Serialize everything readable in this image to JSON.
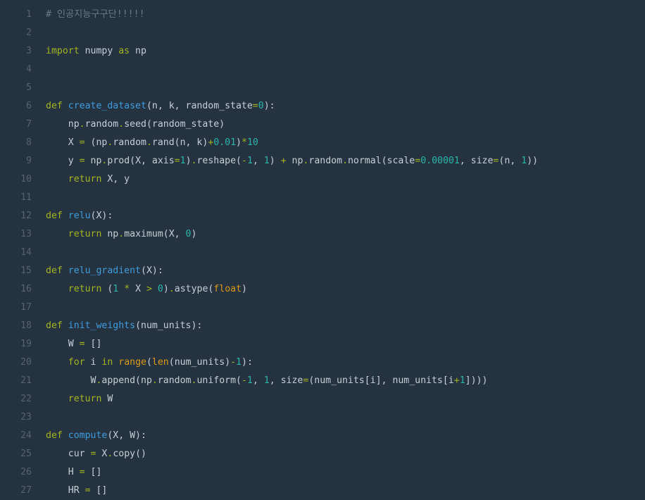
{
  "editor": {
    "lines": [
      {
        "number": "1",
        "tokens": [
          {
            "t": "# 인공지능구구단!!!!!",
            "k": "comment"
          }
        ]
      },
      {
        "number": "2",
        "tokens": []
      },
      {
        "number": "3",
        "tokens": [
          {
            "t": "import",
            "k": "keyword"
          },
          {
            "t": " numpy ",
            "k": "text"
          },
          {
            "t": "as",
            "k": "keyword"
          },
          {
            "t": " np",
            "k": "text"
          }
        ]
      },
      {
        "number": "4",
        "tokens": []
      },
      {
        "number": "5",
        "tokens": []
      },
      {
        "number": "6",
        "tokens": [
          {
            "t": "def",
            "k": "keyword"
          },
          {
            "t": " ",
            "k": "text"
          },
          {
            "t": "create_dataset",
            "k": "func"
          },
          {
            "t": "(n, k, random_state",
            "k": "text"
          },
          {
            "t": "=",
            "k": "op"
          },
          {
            "t": "0",
            "k": "number"
          },
          {
            "t": "):",
            "k": "text"
          }
        ]
      },
      {
        "number": "7",
        "tokens": [
          {
            "t": "    np",
            "k": "text"
          },
          {
            "t": ".",
            "k": "op"
          },
          {
            "t": "random",
            "k": "text"
          },
          {
            "t": ".",
            "k": "op"
          },
          {
            "t": "seed(random_state)",
            "k": "text"
          }
        ]
      },
      {
        "number": "8",
        "tokens": [
          {
            "t": "    X ",
            "k": "text"
          },
          {
            "t": "=",
            "k": "op"
          },
          {
            "t": " (np",
            "k": "text"
          },
          {
            "t": ".",
            "k": "op"
          },
          {
            "t": "random",
            "k": "text"
          },
          {
            "t": ".",
            "k": "op"
          },
          {
            "t": "rand(n, k)",
            "k": "text"
          },
          {
            "t": "+",
            "k": "op"
          },
          {
            "t": "0.01",
            "k": "number"
          },
          {
            "t": ")",
            "k": "text"
          },
          {
            "t": "*",
            "k": "op"
          },
          {
            "t": "10",
            "k": "number"
          }
        ]
      },
      {
        "number": "9",
        "tokens": [
          {
            "t": "    y ",
            "k": "text"
          },
          {
            "t": "=",
            "k": "op"
          },
          {
            "t": " np",
            "k": "text"
          },
          {
            "t": ".",
            "k": "op"
          },
          {
            "t": "prod(X, axis",
            "k": "text"
          },
          {
            "t": "=",
            "k": "op"
          },
          {
            "t": "1",
            "k": "number"
          },
          {
            "t": ")",
            "k": "text"
          },
          {
            "t": ".",
            "k": "op"
          },
          {
            "t": "reshape(",
            "k": "text"
          },
          {
            "t": "-",
            "k": "op"
          },
          {
            "t": "1",
            "k": "number"
          },
          {
            "t": ", ",
            "k": "text"
          },
          {
            "t": "1",
            "k": "number"
          },
          {
            "t": ") ",
            "k": "text"
          },
          {
            "t": "+",
            "k": "op"
          },
          {
            "t": " np",
            "k": "text"
          },
          {
            "t": ".",
            "k": "op"
          },
          {
            "t": "random",
            "k": "text"
          },
          {
            "t": ".",
            "k": "op"
          },
          {
            "t": "normal(scale",
            "k": "text"
          },
          {
            "t": "=",
            "k": "op"
          },
          {
            "t": "0.00001",
            "k": "number"
          },
          {
            "t": ", size",
            "k": "text"
          },
          {
            "t": "=",
            "k": "op"
          },
          {
            "t": "(n, ",
            "k": "text"
          },
          {
            "t": "1",
            "k": "number"
          },
          {
            "t": "))",
            "k": "text"
          }
        ]
      },
      {
        "number": "10",
        "tokens": [
          {
            "t": "    ",
            "k": "text"
          },
          {
            "t": "return",
            "k": "keyword"
          },
          {
            "t": " X, y",
            "k": "text"
          }
        ]
      },
      {
        "number": "11",
        "tokens": []
      },
      {
        "number": "12",
        "tokens": [
          {
            "t": "def",
            "k": "keyword"
          },
          {
            "t": " ",
            "k": "text"
          },
          {
            "t": "relu",
            "k": "func"
          },
          {
            "t": "(X):",
            "k": "text"
          }
        ]
      },
      {
        "number": "13",
        "tokens": [
          {
            "t": "    ",
            "k": "text"
          },
          {
            "t": "return",
            "k": "keyword"
          },
          {
            "t": " np",
            "k": "text"
          },
          {
            "t": ".",
            "k": "op"
          },
          {
            "t": "maximum(X, ",
            "k": "text"
          },
          {
            "t": "0",
            "k": "number"
          },
          {
            "t": ")",
            "k": "text"
          }
        ]
      },
      {
        "number": "14",
        "tokens": []
      },
      {
        "number": "15",
        "tokens": [
          {
            "t": "def",
            "k": "keyword"
          },
          {
            "t": " ",
            "k": "text"
          },
          {
            "t": "relu_gradient",
            "k": "func"
          },
          {
            "t": "(X):",
            "k": "text"
          }
        ]
      },
      {
        "number": "16",
        "tokens": [
          {
            "t": "    ",
            "k": "text"
          },
          {
            "t": "return",
            "k": "keyword"
          },
          {
            "t": " (",
            "k": "text"
          },
          {
            "t": "1",
            "k": "number"
          },
          {
            "t": " ",
            "k": "text"
          },
          {
            "t": "*",
            "k": "op"
          },
          {
            "t": " X ",
            "k": "text"
          },
          {
            "t": ">",
            "k": "op"
          },
          {
            "t": " ",
            "k": "text"
          },
          {
            "t": "0",
            "k": "number"
          },
          {
            "t": ")",
            "k": "text"
          },
          {
            "t": ".",
            "k": "op"
          },
          {
            "t": "astype(",
            "k": "text"
          },
          {
            "t": "float",
            "k": "builtin"
          },
          {
            "t": ")",
            "k": "text"
          }
        ]
      },
      {
        "number": "17",
        "tokens": []
      },
      {
        "number": "18",
        "tokens": [
          {
            "t": "def",
            "k": "keyword"
          },
          {
            "t": " ",
            "k": "text"
          },
          {
            "t": "init_weights",
            "k": "func"
          },
          {
            "t": "(num_units):",
            "k": "text"
          }
        ]
      },
      {
        "number": "19",
        "tokens": [
          {
            "t": "    W ",
            "k": "text"
          },
          {
            "t": "=",
            "k": "op"
          },
          {
            "t": " []",
            "k": "text"
          }
        ]
      },
      {
        "number": "20",
        "tokens": [
          {
            "t": "    ",
            "k": "text"
          },
          {
            "t": "for",
            "k": "keyword"
          },
          {
            "t": " i ",
            "k": "text"
          },
          {
            "t": "in",
            "k": "keyword"
          },
          {
            "t": " ",
            "k": "text"
          },
          {
            "t": "range",
            "k": "builtin"
          },
          {
            "t": "(",
            "k": "text"
          },
          {
            "t": "len",
            "k": "builtin"
          },
          {
            "t": "(num_units)",
            "k": "text"
          },
          {
            "t": "-",
            "k": "op"
          },
          {
            "t": "1",
            "k": "number"
          },
          {
            "t": "):",
            "k": "text"
          }
        ]
      },
      {
        "number": "21",
        "tokens": [
          {
            "t": "        W",
            "k": "text"
          },
          {
            "t": ".",
            "k": "op"
          },
          {
            "t": "append(np",
            "k": "text"
          },
          {
            "t": ".",
            "k": "op"
          },
          {
            "t": "random",
            "k": "text"
          },
          {
            "t": ".",
            "k": "op"
          },
          {
            "t": "uniform(",
            "k": "text"
          },
          {
            "t": "-",
            "k": "op"
          },
          {
            "t": "1",
            "k": "number"
          },
          {
            "t": ", ",
            "k": "text"
          },
          {
            "t": "1",
            "k": "number"
          },
          {
            "t": ", size",
            "k": "text"
          },
          {
            "t": "=",
            "k": "op"
          },
          {
            "t": "(num_units[i], num_units[i",
            "k": "text"
          },
          {
            "t": "+",
            "k": "op"
          },
          {
            "t": "1",
            "k": "number"
          },
          {
            "t": "])))",
            "k": "text"
          }
        ]
      },
      {
        "number": "22",
        "tokens": [
          {
            "t": "    ",
            "k": "text"
          },
          {
            "t": "return",
            "k": "keyword"
          },
          {
            "t": " W",
            "k": "text"
          }
        ]
      },
      {
        "number": "23",
        "tokens": []
      },
      {
        "number": "24",
        "tokens": [
          {
            "t": "def",
            "k": "keyword"
          },
          {
            "t": " ",
            "k": "text"
          },
          {
            "t": "compute",
            "k": "func"
          },
          {
            "t": "(X, W):",
            "k": "text"
          }
        ]
      },
      {
        "number": "25",
        "tokens": [
          {
            "t": "    cur ",
            "k": "text"
          },
          {
            "t": "=",
            "k": "op"
          },
          {
            "t": " X",
            "k": "text"
          },
          {
            "t": ".",
            "k": "op"
          },
          {
            "t": "copy()",
            "k": "text"
          }
        ]
      },
      {
        "number": "26",
        "tokens": [
          {
            "t": "    H ",
            "k": "text"
          },
          {
            "t": "=",
            "k": "op"
          },
          {
            "t": " []",
            "k": "text"
          }
        ]
      },
      {
        "number": "27",
        "tokens": [
          {
            "t": "    HR ",
            "k": "text"
          },
          {
            "t": "=",
            "k": "op"
          },
          {
            "t": " []",
            "k": "text"
          }
        ]
      }
    ]
  }
}
